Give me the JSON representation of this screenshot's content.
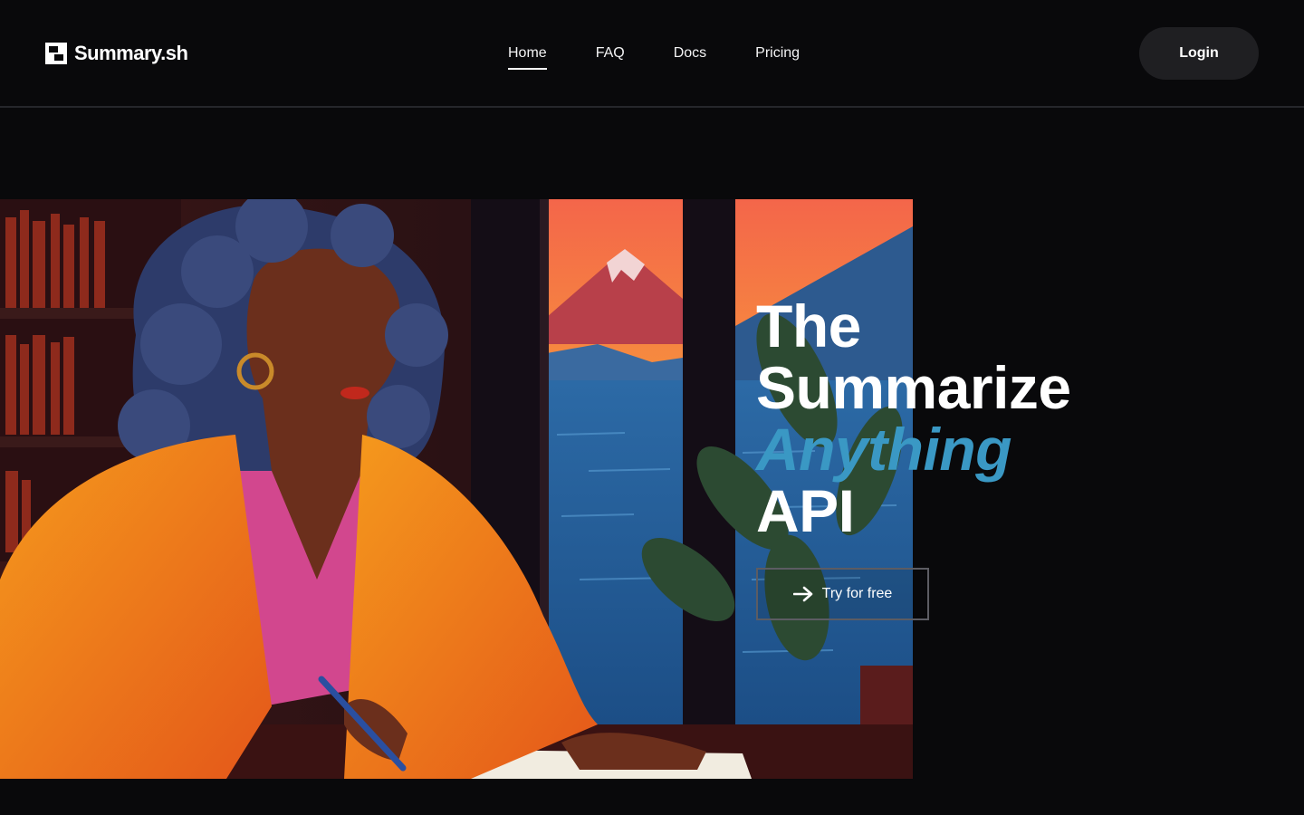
{
  "brand": {
    "name": "Summary.sh",
    "icon": "logo-mark-icon"
  },
  "nav": {
    "items": [
      {
        "label": "Home",
        "active": true
      },
      {
        "label": "FAQ",
        "active": false
      },
      {
        "label": "Docs",
        "active": false
      },
      {
        "label": "Pricing",
        "active": false
      }
    ]
  },
  "header": {
    "login_label": "Login"
  },
  "hero": {
    "headline": [
      "The",
      "Summarize",
      "Anything",
      "API"
    ],
    "accent_word": "Anything",
    "cta_label": "Try for free",
    "cta_icon": "arrow-right-icon",
    "image_subject": "illustration-woman-writing-by-window"
  },
  "colors": {
    "background": "#09090b",
    "accent": "#3a98c4",
    "button_bg": "#1f1f22"
  }
}
